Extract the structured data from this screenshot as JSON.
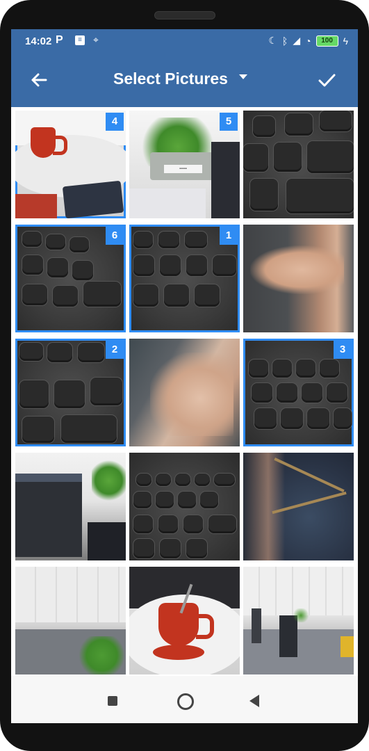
{
  "status_bar": {
    "time": "14:02",
    "battery": "100"
  },
  "app_bar": {
    "title": "Select Pictures"
  },
  "grid": {
    "tiles": [
      {
        "photo": "mug-on-desk",
        "selected": true,
        "badge": "4"
      },
      {
        "photo": "plant-on-desk",
        "selected": true,
        "badge": "5"
      },
      {
        "photo": "keyboard",
        "selected": false,
        "badge": ""
      },
      {
        "photo": "keyboard",
        "selected": true,
        "badge": "6"
      },
      {
        "photo": "keyboard",
        "selected": true,
        "badge": "1"
      },
      {
        "photo": "finger-over-keyboard",
        "selected": false,
        "badge": ""
      },
      {
        "photo": "keyboard",
        "selected": true,
        "badge": "2"
      },
      {
        "photo": "blurred-hand",
        "selected": false,
        "badge": ""
      },
      {
        "photo": "keyboard",
        "selected": true,
        "badge": "3"
      },
      {
        "photo": "office-monitor",
        "selected": false,
        "badge": ""
      },
      {
        "photo": "keyboard",
        "selected": false,
        "badge": ""
      },
      {
        "photo": "jeans",
        "selected": false,
        "badge": ""
      },
      {
        "photo": "office",
        "selected": false,
        "badge": ""
      },
      {
        "photo": "red-mug",
        "selected": false,
        "badge": ""
      },
      {
        "photo": "office",
        "selected": false,
        "badge": ""
      }
    ]
  },
  "accent_color": "#2f8cf3",
  "appbar_color": "#3a6ba6"
}
